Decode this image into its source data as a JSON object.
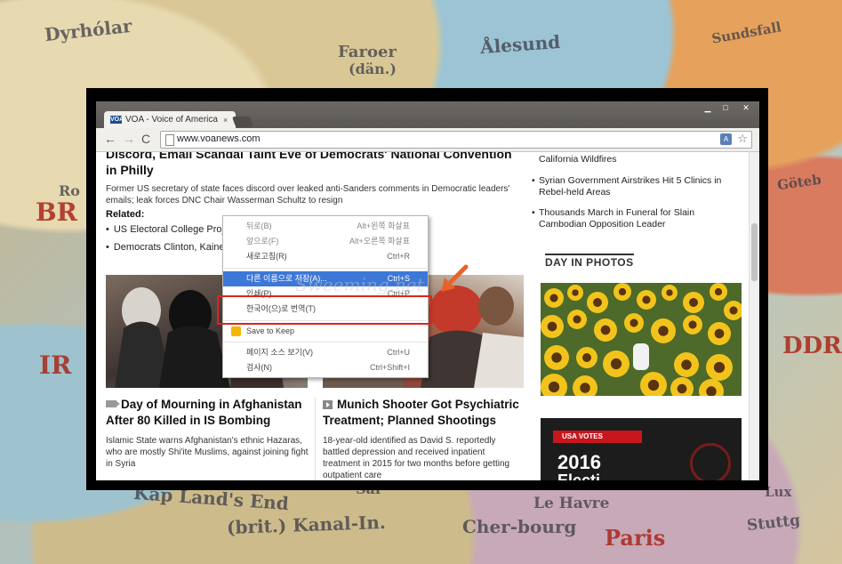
{
  "map": {
    "labels": [
      "Dyrhólar",
      "Faroer",
      "(dän.)",
      "Ålesund",
      "Sundsfall",
      "Ro",
      "BR",
      "Göteb",
      "IR",
      "DDR",
      "Kap Land's End",
      "(brit.) Kanal-In.",
      "Cher-bourg",
      "Paris",
      "Le Havre",
      "Stuttg",
      "Lux",
      "Sai"
    ]
  },
  "browser": {
    "tab_favicon": "VOA",
    "tab_title": "VOA - Voice of America",
    "tab_close": "×",
    "window_controls": {
      "minimize": "▁",
      "maximize": "□",
      "close": "✕"
    },
    "nav": {
      "back": "←",
      "forward": "→",
      "reload": "C"
    },
    "url": "www.voanews.com",
    "translate_icon": "translate-icon",
    "star_icon": "☆"
  },
  "page": {
    "lead_headline": "Discord, Email Scandal Taint Eve of Democrats' National Convention in Philly",
    "lead_summary": "Former US secretary of state faces discord over leaked anti-Sanders comments in Democratic leaders' emails; leak forces DNC Chair Wasserman Schultz to resign",
    "related_label": "Related:",
    "related_items": [
      "US Electoral College Proje",
      "Democrats Clinton, Kaine"
    ],
    "sidebar_items": [
      "California Wildfires",
      "Syrian Government Airstrikes Hit 5 Clinics in Rebel-held Areas",
      "Thousands March in Funeral for Slain Cambodian Opposition Leader"
    ],
    "day_in_photos": "DAY IN PHOTOS",
    "articles": [
      {
        "title": "Day of Mourning in Afghanistan After 80 Killed in IS Bombing",
        "desc": "Islamic State warns Afghanistan's ethnic Hazaras, who are mostly Shi'ite Muslims, against joining fight in Syria"
      },
      {
        "title": "Munich Shooter Got Psychiatric Treatment; Planned Shootings",
        "desc": "18-year-old identified as David S. reportedly battled depression and received inpatient treatment in 2015 for two months before getting outpatient care"
      }
    ],
    "usa_votes": {
      "tag": "USA VOTES",
      "year": "2016",
      "sub": "Electi"
    }
  },
  "context_menu": {
    "items": [
      {
        "label": "뒤로(B)",
        "key": "Alt+왼쪽 화살표",
        "state": "disabled"
      },
      {
        "label": "앞으로(F)",
        "key": "Alt+오른쪽 화살표",
        "state": "disabled"
      },
      {
        "label": "새로고침(R)",
        "key": "Ctrl+R",
        "state": "normal"
      },
      {
        "label": "다른 이름으로 저장(A)...",
        "key": "Ctrl+S",
        "state": "highlight"
      },
      {
        "label": "인쇄(P)...",
        "key": "Ctrl+P",
        "state": "normal"
      },
      {
        "label": "한국어(으)로 번역(T)",
        "key": "",
        "state": "normal"
      },
      {
        "label": "Save to Keep",
        "key": "",
        "state": "normal"
      },
      {
        "label": "페이지 소스 보기(V)",
        "key": "Ctrl+U",
        "state": "normal"
      },
      {
        "label": "검사(N)",
        "key": "Ctrl+Shift+I",
        "state": "normal"
      }
    ]
  },
  "watermark": "Sweeming.net",
  "colors": {
    "highlight": "#3d78d8",
    "annotation": "#e0241b",
    "arrow": "#e8632b"
  }
}
